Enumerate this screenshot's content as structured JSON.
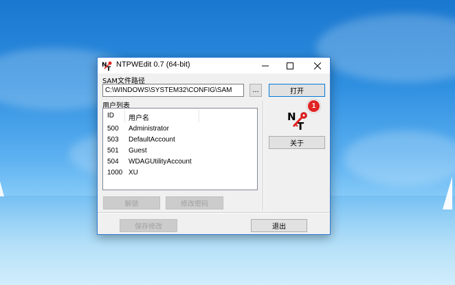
{
  "window": {
    "title": "NTPWEdit 0.7 (64-bit)",
    "controls": {
      "minimize": "minimize-icon",
      "maximize": "maximize-icon",
      "close": "close-icon"
    }
  },
  "sam": {
    "label": "SAM文件路径",
    "path_value": "C:\\WINDOWS\\SYSTEM32\\CONFIG\\SAM",
    "browse_label": "...",
    "open_label": "打开"
  },
  "users": {
    "label": "用户列表",
    "columns": [
      "ID",
      "用户名"
    ],
    "rows": [
      {
        "id": "500",
        "name": "Administrator"
      },
      {
        "id": "503",
        "name": "DefaultAccount"
      },
      {
        "id": "501",
        "name": "Guest"
      },
      {
        "id": "504",
        "name": "WDAGUtilityAccount"
      },
      {
        "id": "1000",
        "name": "XU"
      }
    ]
  },
  "actions": {
    "unlock_label": "解锁",
    "change_password_label": "修改密码",
    "about_label": "关于",
    "save_label": "保存修改",
    "exit_label": "退出"
  },
  "badge": {
    "count": "1"
  },
  "logo": {
    "text": "NT"
  },
  "colors": {
    "accent": "#0078d7",
    "badge": "#e02424",
    "desktop": "#2f8fe0"
  }
}
